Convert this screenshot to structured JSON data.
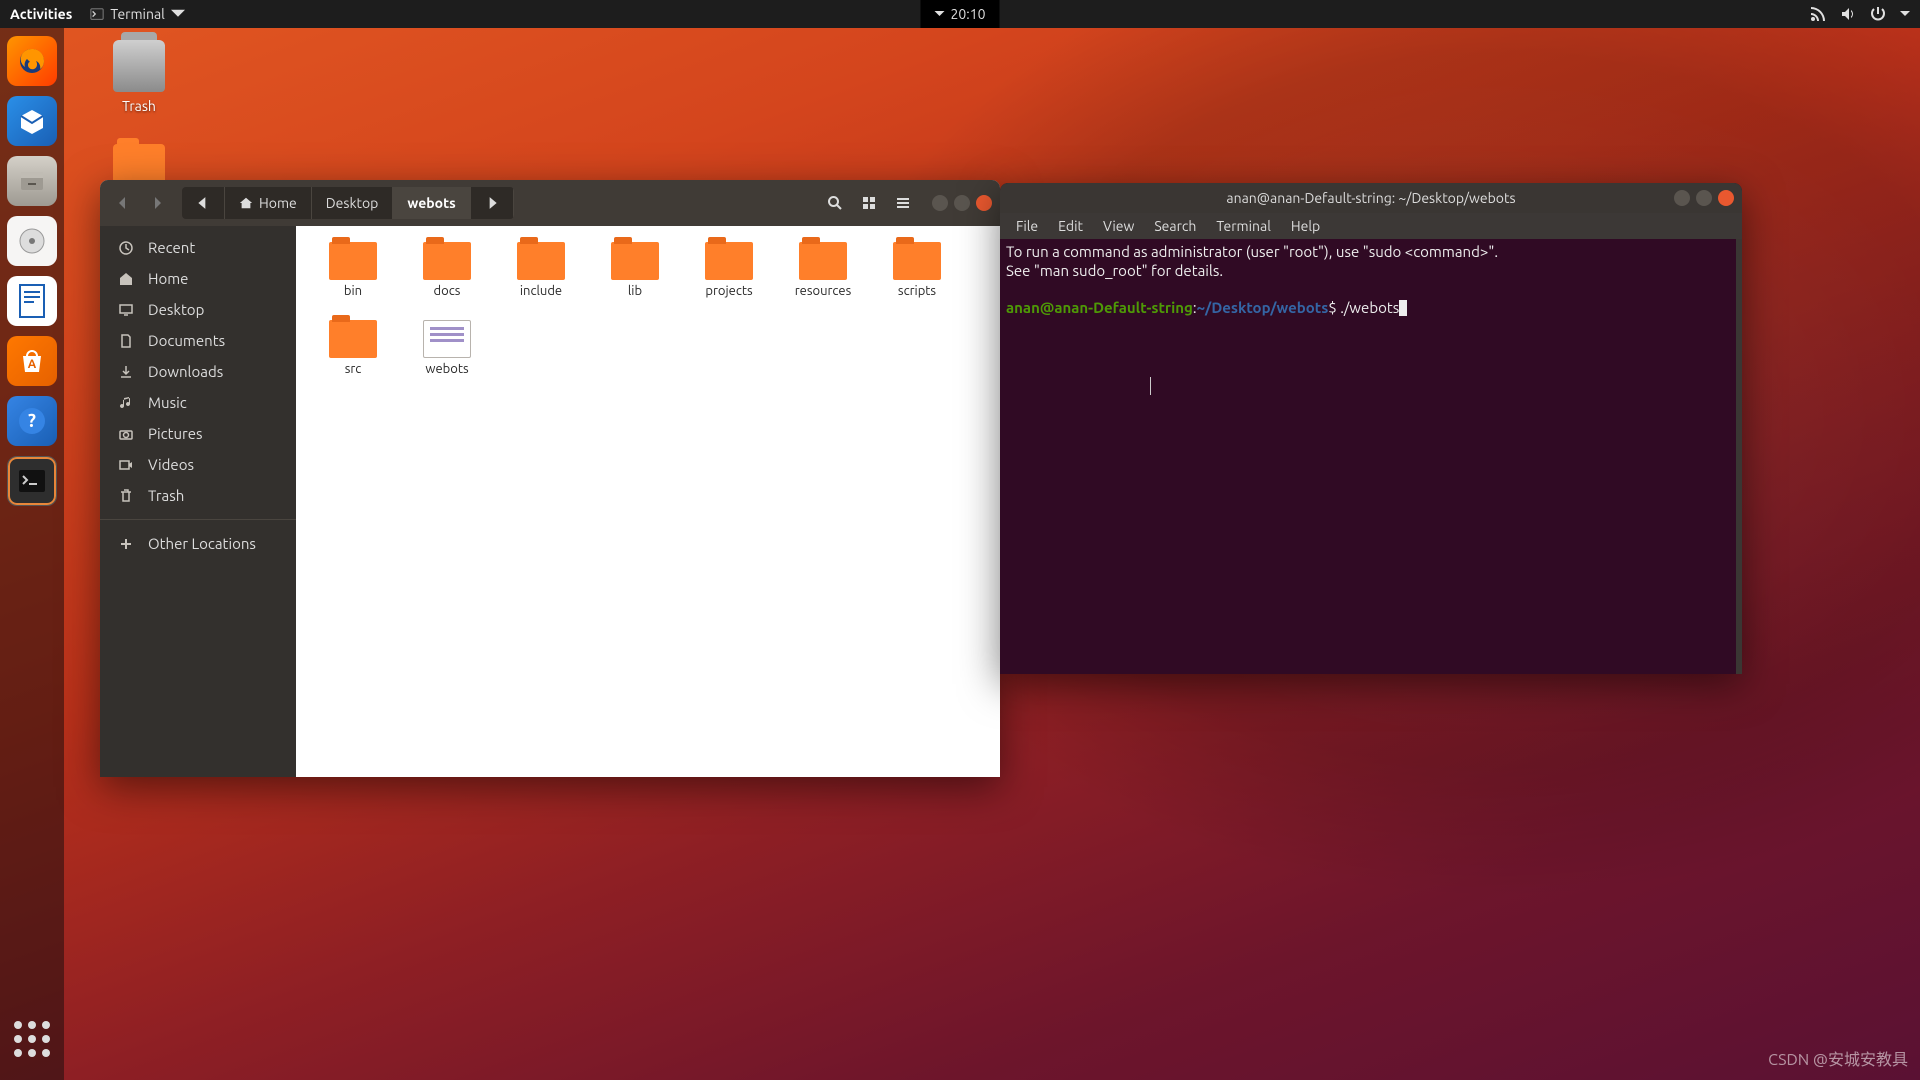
{
  "topbar": {
    "activities": "Activities",
    "app_label": "Terminal",
    "time": "20:10"
  },
  "desktop_icons": {
    "trash": "Trash"
  },
  "dock": {
    "items": [
      "firefox",
      "thunderbird",
      "files",
      "rhythmbox",
      "writer",
      "software",
      "help",
      "terminal"
    ]
  },
  "files_window": {
    "path": {
      "home": "Home",
      "seg1": "Desktop",
      "seg2": "webots"
    },
    "sidebar": {
      "recent": "Recent",
      "home": "Home",
      "desktop": "Desktop",
      "documents": "Documents",
      "downloads": "Downloads",
      "music": "Music",
      "pictures": "Pictures",
      "videos": "Videos",
      "trash": "Trash",
      "other": "Other Locations"
    },
    "items": [
      {
        "name": "bin",
        "type": "folder"
      },
      {
        "name": "docs",
        "type": "folder"
      },
      {
        "name": "include",
        "type": "folder"
      },
      {
        "name": "lib",
        "type": "folder"
      },
      {
        "name": "projects",
        "type": "folder"
      },
      {
        "name": "resources",
        "type": "folder"
      },
      {
        "name": "scripts",
        "type": "folder"
      },
      {
        "name": "src",
        "type": "folder"
      },
      {
        "name": "webots",
        "type": "file"
      }
    ]
  },
  "terminal": {
    "title": "anan@anan-Default-string: ~/Desktop/webots",
    "menu": {
      "file": "File",
      "edit": "Edit",
      "view": "View",
      "search": "Search",
      "terminal": "Terminal",
      "help": "Help"
    },
    "line1": "To run a command as administrator (user \"root\"), use \"sudo <command>\".",
    "line2": "See \"man sudo_root\" for details.",
    "prompt_user": "anan@anan-Default-string",
    "prompt_sep": ":",
    "prompt_path": "~/Desktop/webots",
    "prompt_dollar": "$ ",
    "command": "./webots"
  },
  "watermark": "CSDN @安城安教具"
}
